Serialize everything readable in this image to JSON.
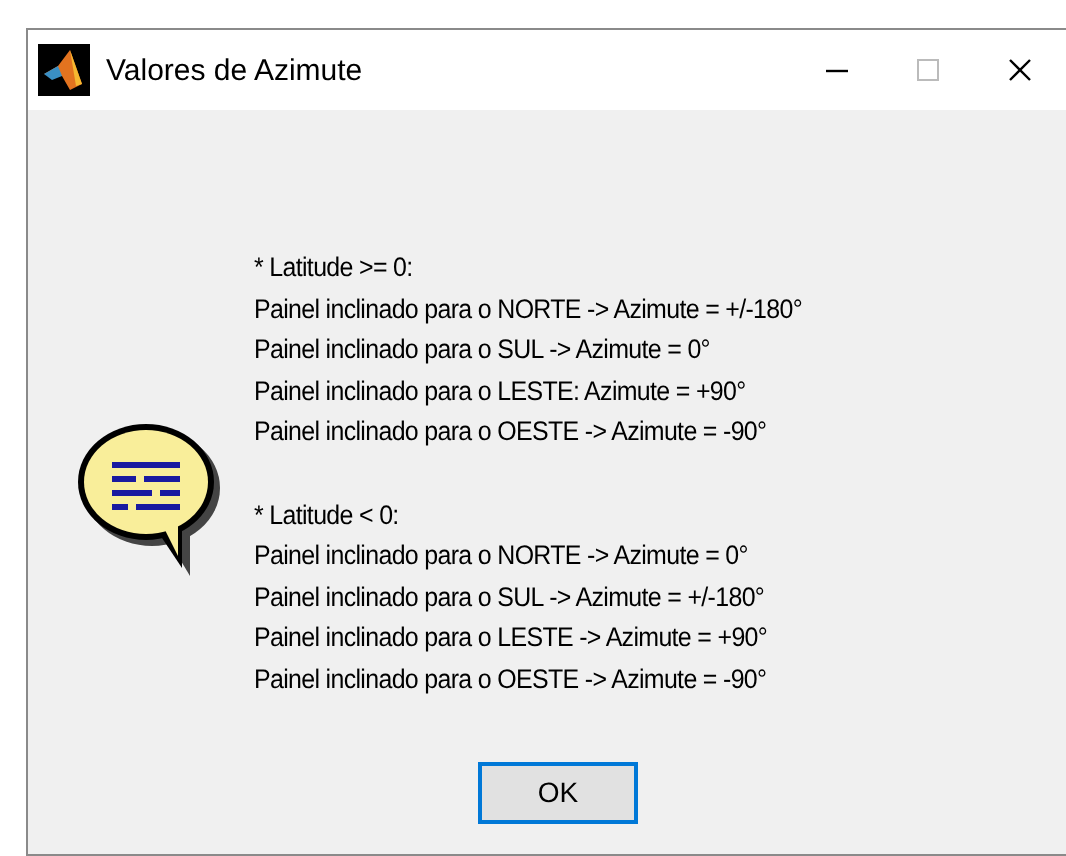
{
  "window": {
    "title": "Valores de Azimute"
  },
  "message": {
    "groups": [
      {
        "heading": "* Latitude >= 0:",
        "lines": [
          "Painel inclinado para o NORTE -> Azimute = +/-180°",
          "Painel inclinado para o SUL -> Azimute = 0°",
          "Painel inclinado para o LESTE: Azimute = +90°",
          "Painel inclinado para o OESTE -> Azimute = -90°"
        ]
      },
      {
        "heading": "* Latitude < 0:",
        "lines": [
          "Painel inclinado para o NORTE -> Azimute = 0°",
          "Painel inclinado para o SUL -> Azimute = +/-180°",
          "Painel inclinado para o LESTE -> Azimute = +90°",
          "Painel inclinado para o OESTE -> Azimute = -90°"
        ]
      }
    ]
  },
  "buttons": [
    "OK"
  ]
}
